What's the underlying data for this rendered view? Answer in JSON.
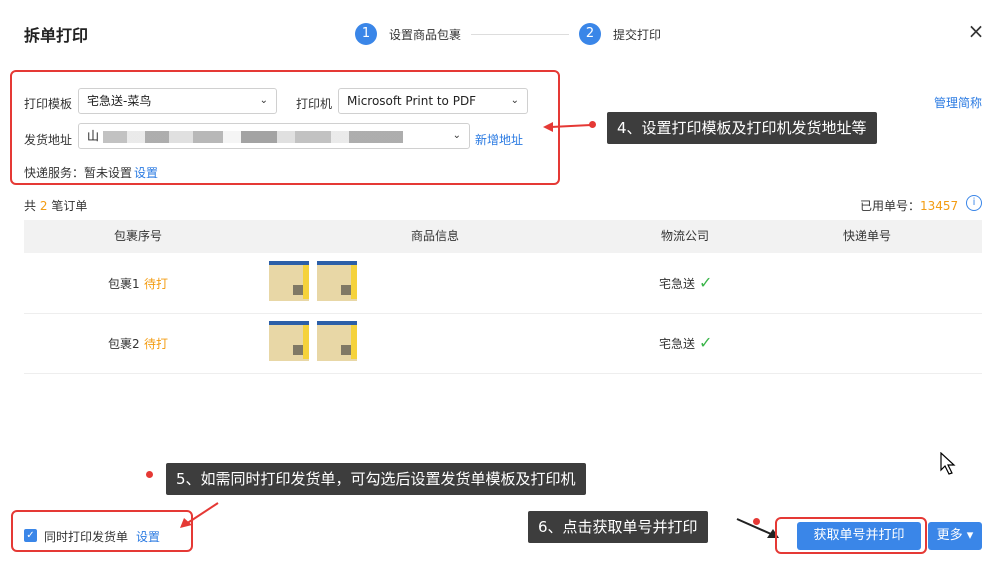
{
  "dialog": {
    "title": "拆单打印",
    "close_icon": "×"
  },
  "steps": [
    {
      "number": "1",
      "label": "设置商品包裹"
    },
    {
      "number": "2",
      "label": "提交打印"
    }
  ],
  "form": {
    "template_label": "打印模板",
    "template_value": "宅急送-菜鸟",
    "printer_label": "打印机",
    "printer_value": "Microsoft Print to PDF",
    "address_label": "发货地址",
    "address_value_prefix": "山",
    "new_address_link": "新增地址",
    "express_service_label": "快递服务：",
    "express_service_value": "暂未设置",
    "express_service_link": "设置",
    "manage_short_names_link": "管理简称"
  },
  "summary": {
    "total_prefix": "共",
    "total_count": "2",
    "total_suffix": "笔订单",
    "used_label": "已用单号：",
    "used_value": "13457"
  },
  "table": {
    "columns": [
      "包裹序号",
      "商品信息",
      "物流公司",
      "快递单号"
    ],
    "rows": [
      {
        "package": "包裹1",
        "status": "待打",
        "carrier": "宅急送",
        "tracking": ""
      },
      {
        "package": "包裹2",
        "status": "待打",
        "carrier": "宅急送",
        "tracking": ""
      }
    ]
  },
  "footer": {
    "print_invoice_label": "同时打印发货单",
    "print_invoice_settings": "设置",
    "primary_button": "获取单号并打印",
    "more_button": "更多"
  },
  "annotations": {
    "a4": "4、设置打印模板及打印机发货地址等",
    "a5": "5、如需同时打印发货单，可勾选后设置发货单模板及打印机",
    "a6": "6、点击获取单号并打印"
  },
  "colors": {
    "accent": "#3a86e8",
    "annotation_red": "#e53935",
    "pending_orange": "#f39c12",
    "check_green": "#3bb54a"
  }
}
